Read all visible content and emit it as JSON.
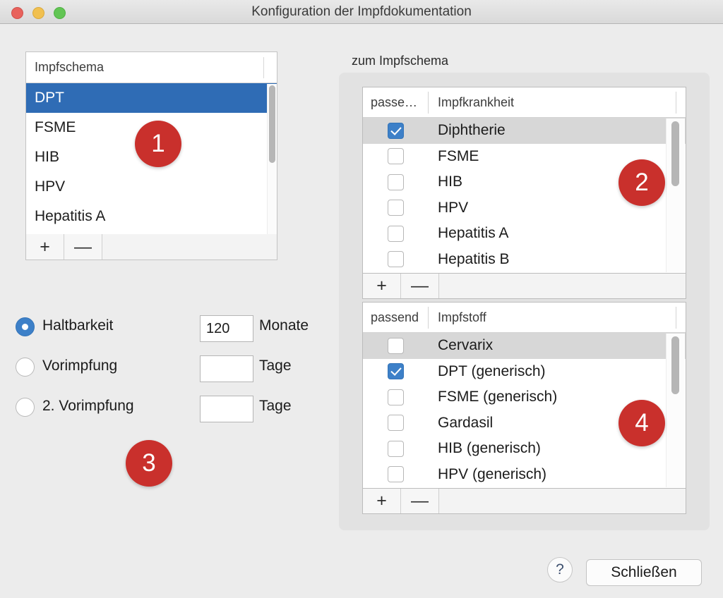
{
  "window": {
    "title": "Konfiguration der Impfdokumentation",
    "traffic_lights": {
      "close": "close-button-red",
      "minimize": "minimize-button-yellow",
      "maximize": "maximize-button-green"
    },
    "accent_color": "#3d80c8",
    "selection_color": "#2f6cb5",
    "badge_color": "#c9302c"
  },
  "schema_list": {
    "header": "Impfschema",
    "items": [
      {
        "label": "DPT",
        "selected": true
      },
      {
        "label": "FSME",
        "selected": false
      },
      {
        "label": "HIB",
        "selected": false
      },
      {
        "label": "HPV",
        "selected": false
      },
      {
        "label": "Hepatitis A",
        "selected": false
      }
    ],
    "footer": {
      "add": "+",
      "remove": "—"
    }
  },
  "options": {
    "rows": [
      {
        "label": "Haltbarkeit",
        "selected": true,
        "value": "120",
        "unit": "Monate"
      },
      {
        "label": "Vorimpfung",
        "selected": false,
        "value": "",
        "unit": "Tage"
      },
      {
        "label": "2. Vorimpfung",
        "selected": false,
        "value": "",
        "unit": "Tage"
      }
    ]
  },
  "right_panel": {
    "caption": "zum Impfschema",
    "disease_table": {
      "columns": {
        "check": "passe…",
        "name": "Impfkrankheit"
      },
      "rows": [
        {
          "label": "Diphtherie",
          "checked": true,
          "highlighted": true
        },
        {
          "label": "FSME",
          "checked": false,
          "highlighted": false
        },
        {
          "label": "HIB",
          "checked": false,
          "highlighted": false
        },
        {
          "label": "HPV",
          "checked": false,
          "highlighted": false
        },
        {
          "label": "Hepatitis A",
          "checked": false,
          "highlighted": false
        },
        {
          "label": "Hepatitis B",
          "checked": false,
          "highlighted": false
        }
      ],
      "footer": {
        "add": "+",
        "remove": "—"
      }
    },
    "vaccine_table": {
      "columns": {
        "check": "passend",
        "name": "Impfstoff"
      },
      "rows": [
        {
          "label": "Cervarix",
          "checked": false,
          "highlighted": true
        },
        {
          "label": "DPT (generisch)",
          "checked": true,
          "highlighted": false
        },
        {
          "label": "FSME (generisch)",
          "checked": false,
          "highlighted": false
        },
        {
          "label": "Gardasil",
          "checked": false,
          "highlighted": false
        },
        {
          "label": "HIB (generisch)",
          "checked": false,
          "highlighted": false
        },
        {
          "label": "HPV (generisch)",
          "checked": false,
          "highlighted": false
        }
      ],
      "footer": {
        "add": "+",
        "remove": "—"
      }
    }
  },
  "badges": [
    {
      "number": "1"
    },
    {
      "number": "2"
    },
    {
      "number": "3"
    },
    {
      "number": "4"
    }
  ],
  "bottom_bar": {
    "help_label": "?",
    "close_label": "Schließen"
  }
}
